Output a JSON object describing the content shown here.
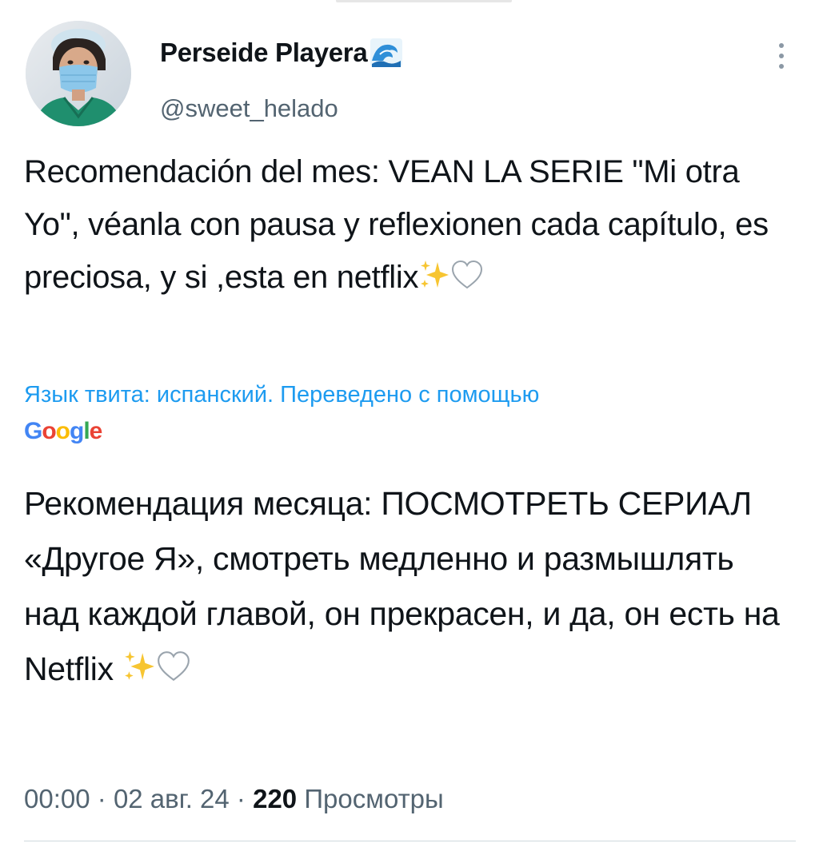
{
  "author": {
    "display_name": "Perseide Playera",
    "name_emoji": "wave-icon",
    "handle": "@sweet_helado"
  },
  "tweet": {
    "text": "Recomendación del mes: VEAN LA SERIE \"Mi otra Yo\", véanla con pausa y reflexionen cada capítulo, es preciosa, y si ,esta en netflix",
    "trailing_emojis": [
      "sparkles-icon",
      "white-heart-icon"
    ]
  },
  "translation": {
    "note": "Язык твита: испанский. Переведено с помощью",
    "provider": "Google",
    "text": "Рекомендация месяца: ПОСМОТРЕТЬ СЕРИАЛ «Другое Я», смотреть медленно и размышлять над каждой главой, он прекрасен, и да, он есть на Netflix"
  },
  "meta": {
    "time": "00:00",
    "separator": "·",
    "date": "02 авг. 24",
    "views_count": "220",
    "views_label": "Просмотры"
  },
  "colors": {
    "link_blue": "#1d9bf0",
    "secondary_text": "#536471",
    "primary_text": "#0f1419"
  }
}
